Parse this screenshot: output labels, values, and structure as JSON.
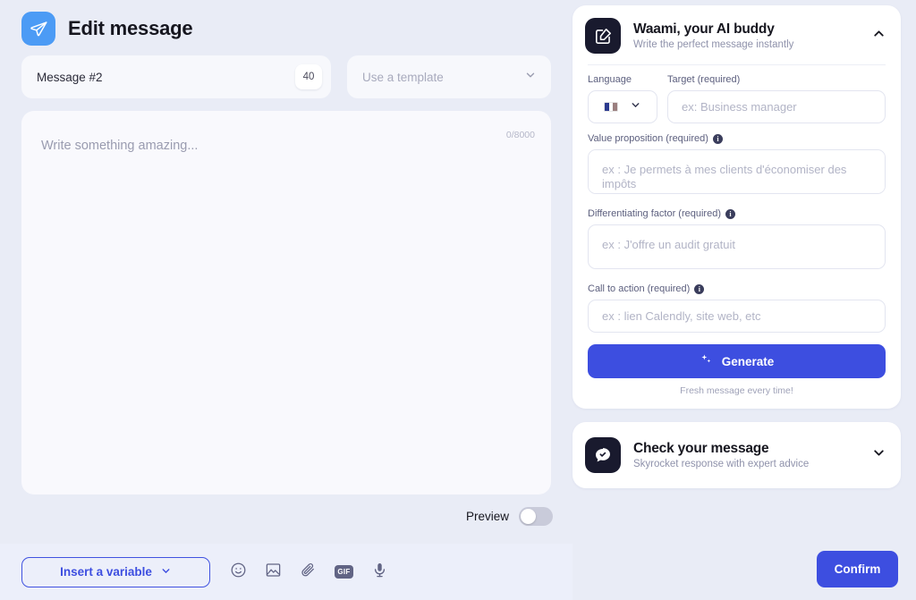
{
  "header": {
    "title": "Edit message",
    "send_icon": "paper-plane-icon"
  },
  "message_meta": {
    "name": "Message #2",
    "char_badge": "40",
    "template_placeholder": "Use a template",
    "template_chevron": "chevron-down-icon"
  },
  "editor": {
    "placeholder": "Write something amazing...",
    "counter": "0/8000"
  },
  "preview": {
    "label": "Preview",
    "enabled": false
  },
  "toolbar": {
    "insert_variable_label": "Insert a variable",
    "icons": [
      {
        "name": "emoji-icon",
        "label": "Emoji"
      },
      {
        "name": "image-icon",
        "label": "Image"
      },
      {
        "name": "attachment-icon",
        "label": "Attachment"
      },
      {
        "name": "gif-icon",
        "label": "GIF"
      },
      {
        "name": "microphone-icon",
        "label": "Voice"
      }
    ],
    "gif_text": "GIF",
    "confirm_label": "Confirm"
  },
  "waami_panel": {
    "icon": "edit-square-icon",
    "title": "Waami, your AI buddy",
    "subtitle": "Write the perfect message instantly",
    "chevron": "chevron-up-icon",
    "expanded": true,
    "fields": {
      "language_label": "Language",
      "language_value": "French",
      "language_flag": "flag-france-icon",
      "target_label": "Target (required)",
      "target_placeholder": "ex: Business manager",
      "target_value": "",
      "value_prop_label": "Value proposition (required)",
      "value_prop_placeholder": "ex : Je permets à mes clients d'économiser des impôts",
      "value_prop_value": "",
      "diff_label": "Differentiating factor (required)",
      "diff_placeholder": "ex : J'offre un audit gratuit",
      "diff_value": "",
      "cta_label": "Call to action (required)",
      "cta_placeholder": "ex : lien Calendly, site web, etc",
      "cta_value": ""
    },
    "generate_label": "Generate",
    "generate_icon": "sparkle-icon",
    "generate_note": "Fresh message every time!"
  },
  "check_panel": {
    "icon": "chat-check-icon",
    "title": "Check your message",
    "subtitle": "Skyrocket response with expert advice",
    "chevron": "chevron-down-icon",
    "expanded": false
  },
  "colors": {
    "accent": "#3d4ee0",
    "brand_blue": "#4c9bf5",
    "dark": "#191a2e",
    "background": "#e9ecf6"
  }
}
